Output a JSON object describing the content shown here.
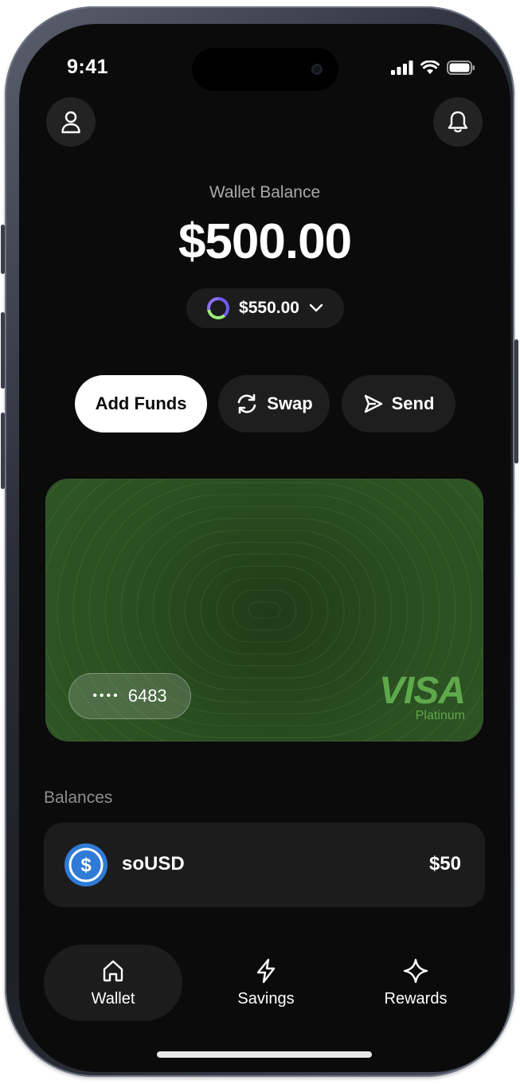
{
  "status_bar": {
    "time": "9:41"
  },
  "header": {
    "profile_icon": "user-icon",
    "notification_icon": "bell-icon"
  },
  "wallet": {
    "label": "Wallet Balance",
    "balance": "$500.00",
    "secondary_balance": "$550.00"
  },
  "actions": [
    {
      "label": "Add Funds",
      "icon": ""
    },
    {
      "label": "Swap",
      "icon": "refresh-icon"
    },
    {
      "label": "Send",
      "icon": "send-icon"
    }
  ],
  "card": {
    "masked_dots": "••••",
    "last_four": "6483",
    "brand": "VISA",
    "tier": "Platinum"
  },
  "balances": {
    "title": "Balances",
    "items": [
      {
        "name": "soUSD",
        "amount": "$50",
        "icon": "usd-coin-icon"
      }
    ]
  },
  "nav": {
    "items": [
      {
        "label": "Wallet",
        "icon": "home-icon",
        "active": true
      },
      {
        "label": "Savings",
        "icon": "lightning-icon",
        "active": false
      },
      {
        "label": "Rewards",
        "icon": "sparkle-icon",
        "active": false
      }
    ]
  },
  "colors": {
    "background": "#0b0b0b",
    "card_green": "#2b5022",
    "visa_green": "#5fa84c",
    "coin_blue": "#2f7bd6"
  }
}
